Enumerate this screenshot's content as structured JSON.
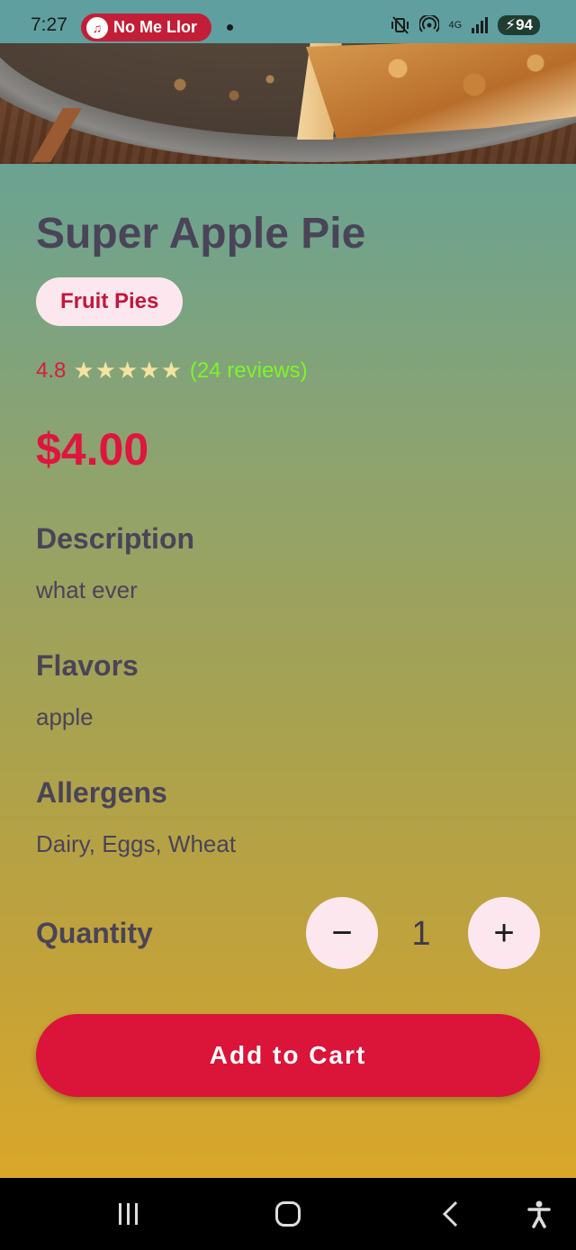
{
  "status_bar": {
    "time": "7:27",
    "media_chip_label": "No Me Llor",
    "network": "4G",
    "battery": "94"
  },
  "product": {
    "title": "Super Apple Pie",
    "category": "Fruit Pies",
    "rating": "4.8",
    "stars": "★★★★★",
    "rating_value": 4.8,
    "rating_max": 5,
    "reviews": "(24 reviews)",
    "price": "$4.00"
  },
  "sections": {
    "description": {
      "title": "Description",
      "body": "what ever"
    },
    "flavors": {
      "title": "Flavors",
      "body": "apple"
    },
    "allergens": {
      "title": "Allergens",
      "body": "Dairy, Eggs, Wheat"
    }
  },
  "quantity": {
    "label": "Quantity",
    "value": "1",
    "decrement": "−",
    "increment": "+"
  },
  "cart": {
    "button_label": "Add to Cart"
  },
  "colors": {
    "accent": "#db1439",
    "chip_bg": "#fde7ef",
    "text": "#4a4458",
    "reviews": "#7cf52a",
    "stars": "#f4e3a0"
  },
  "nav": {
    "icons": [
      "recents-icon",
      "home-icon",
      "back-icon",
      "accessibility-icon"
    ]
  }
}
